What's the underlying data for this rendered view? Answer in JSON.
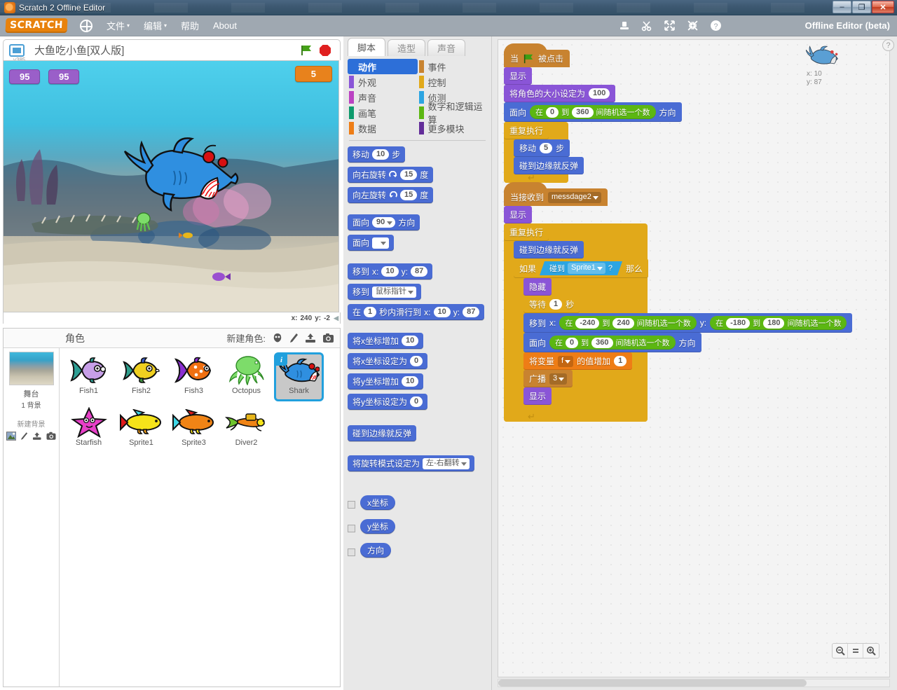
{
  "window": {
    "os_title": "Scratch 2 Offline Editor",
    "minimize": "–",
    "maximize": "❐",
    "close": "✕"
  },
  "menubar": {
    "logo": "SCRATCH",
    "globe_icon": "globe-icon",
    "items": [
      {
        "label": "文件",
        "caret": "▾"
      },
      {
        "label": "编辑",
        "caret": "▾"
      },
      {
        "label": "帮助",
        "caret": ""
      },
      {
        "label": "About",
        "caret": ""
      }
    ],
    "tools": [
      "stamp-icon",
      "scissors-icon",
      "grow-icon",
      "shrink-icon",
      "help-icon"
    ],
    "offline_label": "Offline Editor (beta)"
  },
  "stage": {
    "project_title": "大鱼吃小鱼[双人版]",
    "version": "v385",
    "present_icon": "fullscreen-icon",
    "green_flag": "green-flag-icon",
    "stop_button": "stop-icon",
    "watchers": [
      {
        "name": "score-left",
        "value": "95"
      },
      {
        "name": "score-right",
        "value": "95"
      },
      {
        "name": "score-orange",
        "value": "5"
      }
    ],
    "mouse_x_label": "x:",
    "mouse_x": "240",
    "mouse_y_label": "y:",
    "mouse_y": "-2"
  },
  "sprite_pane": {
    "header": "角色",
    "new_sprite_label": "新建角色:",
    "new_sprite_icons": [
      "paint-new-sprite-icon",
      "brush-icon",
      "upload-icon",
      "camera-icon"
    ],
    "stage_label": "舞台",
    "backdrop_count": "1 背景",
    "new_backdrop_label": "新建背景",
    "new_backdrop_icons": [
      "image-icon",
      "brush-icon",
      "upload-icon",
      "camera-icon"
    ],
    "sprites": [
      {
        "name": "Fish1",
        "selected": false,
        "icon": "fish-purple"
      },
      {
        "name": "Fish2",
        "selected": false,
        "icon": "fish-yellow"
      },
      {
        "name": "Fish3",
        "selected": false,
        "icon": "fish-orange"
      },
      {
        "name": "Octopus",
        "selected": false,
        "icon": "octopus-green"
      },
      {
        "name": "Shark",
        "selected": true,
        "icon": "shark-blue",
        "info_badge": "i"
      },
      {
        "name": "Starfish",
        "selected": false,
        "icon": "starfish-magenta"
      },
      {
        "name": "Sprite1",
        "selected": false,
        "icon": "fish-yellow-2"
      },
      {
        "name": "Sprite3",
        "selected": false,
        "icon": "fish-orange-2"
      },
      {
        "name": "Diver2",
        "selected": false,
        "icon": "diver"
      }
    ]
  },
  "tabs": [
    {
      "label": "脚本",
      "active": true
    },
    {
      "label": "造型",
      "active": false
    },
    {
      "label": "声音",
      "active": false
    }
  ],
  "categories": [
    {
      "label": "动作",
      "color": "#4a6cd4",
      "active": true
    },
    {
      "label": "事件",
      "color": "#c88330",
      "active": false
    },
    {
      "label": "外观",
      "color": "#8a55d7",
      "active": false
    },
    {
      "label": "控制",
      "color": "#e1a91a",
      "active": false
    },
    {
      "label": "声音",
      "color": "#bb42c3",
      "active": false
    },
    {
      "label": "侦测",
      "color": "#2ca5e2",
      "active": false
    },
    {
      "label": "画笔",
      "color": "#0e9a6c",
      "active": false
    },
    {
      "label": "数字和逻辑运算",
      "color": "#5cb712",
      "active": false
    },
    {
      "label": "数据",
      "color": "#ee7d16",
      "active": false
    },
    {
      "label": "更多模块",
      "color": "#632d99",
      "active": false
    }
  ],
  "palette": {
    "move_label": "移动",
    "move_value": "10",
    "move_unit": "步",
    "turn_right_label": "向右旋转",
    "turn_right_icon": "turn-cw-icon",
    "turn_right_value": "15",
    "turn_right_unit": "度",
    "turn_left_label": "向左旋转",
    "turn_left_icon": "turn-ccw-icon",
    "turn_left_value": "15",
    "turn_left_unit": "度",
    "point_dir_label": "面向",
    "point_dir_value": "90",
    "point_dir_suffix": "方向",
    "point_towards_label": "面向",
    "point_towards_value": "",
    "goto_label": "移到",
    "goto_x_label": "x:",
    "goto_x": "10",
    "goto_y_label": "y:",
    "goto_y": "87",
    "goto_target_label": "移到",
    "goto_target_value": "鼠标指针",
    "glide_prefix": "在",
    "glide_secs": "1",
    "glide_mid": "秒内滑行到",
    "glide_x_label": "x:",
    "glide_x": "10",
    "glide_y_label": "y:",
    "glide_y": "87",
    "change_x_label": "将x坐标增加",
    "change_x": "10",
    "set_x_label": "将x坐标设定为",
    "set_x": "0",
    "change_y_label": "将y坐标增加",
    "change_y": "10",
    "set_y_label": "将y坐标设定为",
    "set_y": "0",
    "bounce_label": "碰到边缘就反弹",
    "rotation_label": "将旋转模式设定为",
    "rotation_value": "左-右翻转",
    "reporters": [
      {
        "label": "x坐标",
        "checked": false
      },
      {
        "label": "y坐标",
        "checked": false
      },
      {
        "label": "方向",
        "checked": false
      }
    ]
  },
  "sprite_info": {
    "thumb": "shark-blue",
    "x_label": "x:",
    "x_value": "10",
    "y_label": "y:",
    "y_value": "87",
    "help_icon": "?"
  },
  "scripts": {
    "stack1": {
      "hat_prefix": "当",
      "hat_flag": "green-flag-icon",
      "hat_suffix": "被点击",
      "show": "显示",
      "set_size_label": "将角色的大小设定为",
      "set_size_value": "100",
      "point_label": "面向",
      "point_suffix": "方向",
      "rand_prefix": "在",
      "rand_from": "0",
      "rand_mid": "到",
      "rand_to": "360",
      "rand_suffix": "间随机选一个数",
      "forever": "重复执行",
      "move_label": "移动",
      "move_value": "5",
      "move_unit": "步",
      "bounce": "碰到边缘就反弹"
    },
    "stack2": {
      "hat_prefix": "当接收到",
      "hat_message": "messdage2",
      "show": "显示",
      "forever": "重复执行",
      "bounce": "碰到边缘就反弹",
      "if_prefix": "如果",
      "touching_label": "碰到",
      "touching_target": "Sprite1",
      "touching_q": "?",
      "if_suffix": "那么",
      "hide": "隐藏",
      "wait_label": "等待",
      "wait_value": "1",
      "wait_unit": "秒",
      "goto_label": "移到",
      "goto_x_label": "x:",
      "goto_y_label": "y:",
      "rx_prefix": "在",
      "rx_from": "-240",
      "rx_mid": "到",
      "rx_to": "240",
      "rx_suffix": "间随机选一个数",
      "ry_prefix": "在",
      "ry_from": "-180",
      "ry_mid": "到",
      "ry_to": "180",
      "ry_suffix": "间随机选一个数",
      "point_label": "面向",
      "point_suffix": "方向",
      "pd_prefix": "在",
      "pd_from": "0",
      "pd_mid": "到",
      "pd_to": "360",
      "pd_suffix": "间随机选一个数",
      "change_var_prefix": "将变量",
      "change_var_name": "f",
      "change_var_mid": "的值增加",
      "change_var_value": "1",
      "broadcast_label": "广播",
      "broadcast_value": "3",
      "show2": "显示"
    },
    "zoom_out": "zoom-out-icon",
    "zoom_reset": "zoom-reset-icon",
    "zoom_in": "zoom-in-icon"
  }
}
